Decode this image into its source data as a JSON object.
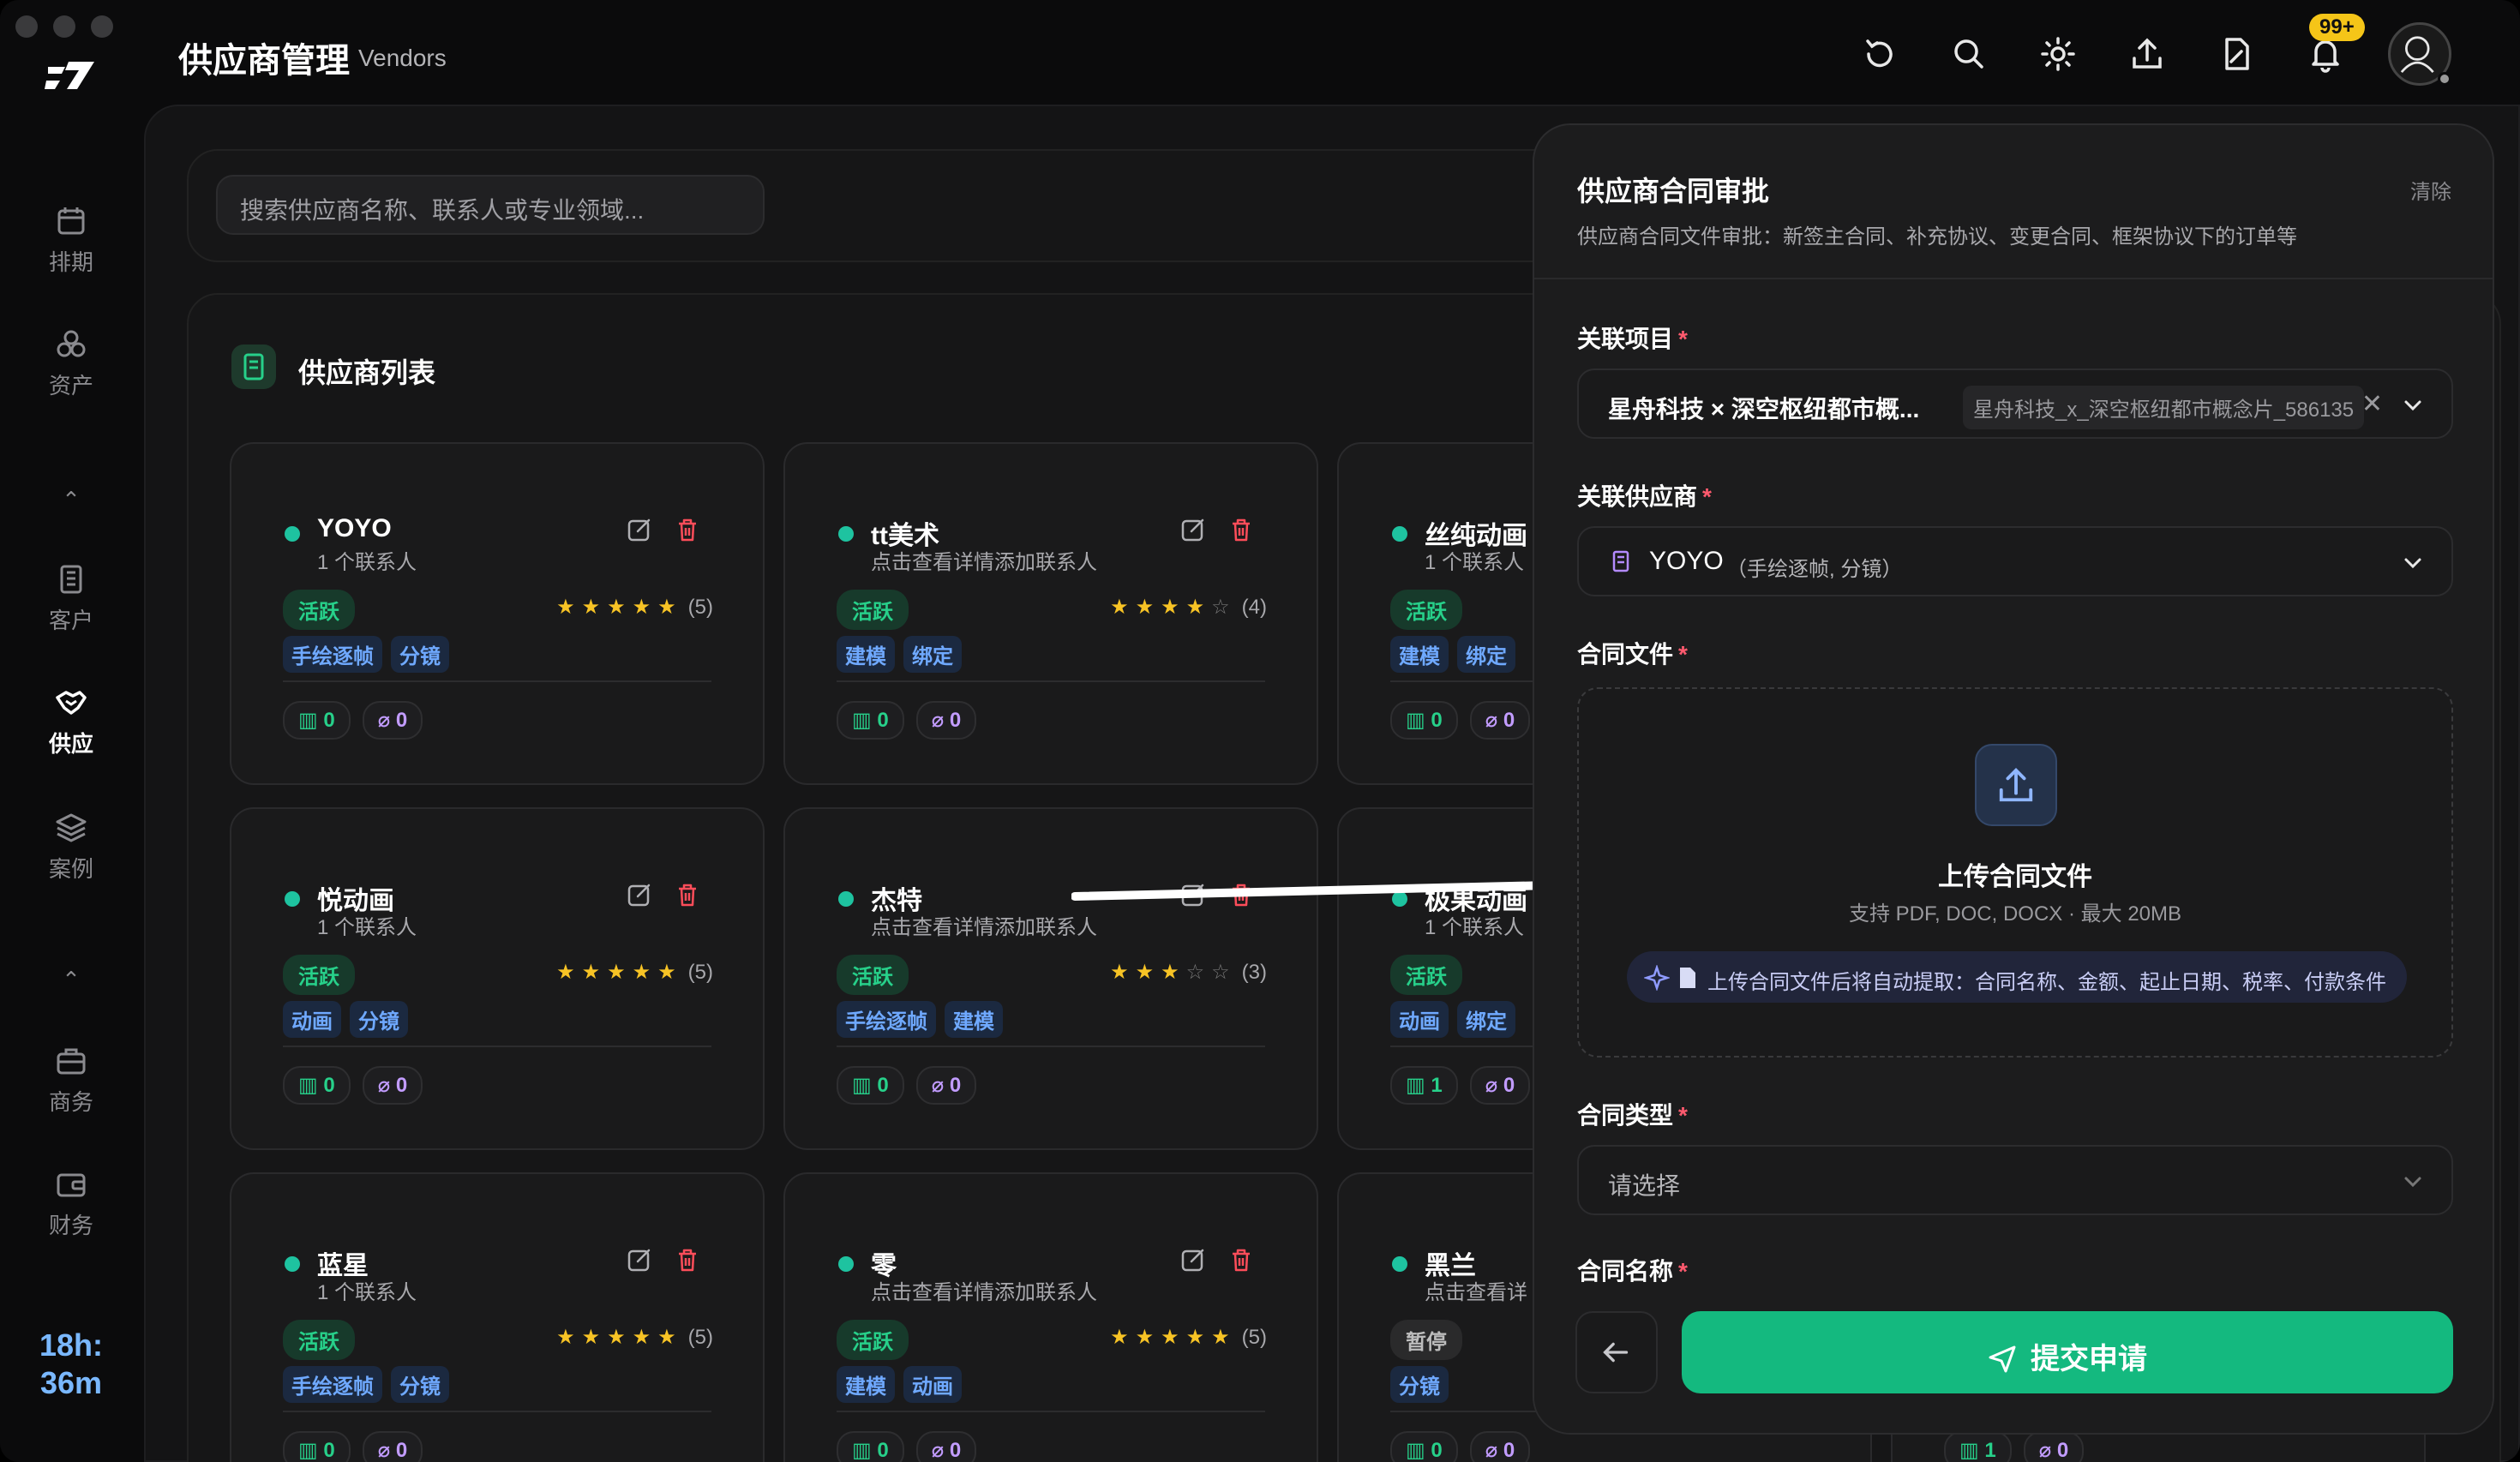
{
  "header": {
    "title": "供应商管理",
    "subtitle": "Vendors",
    "badge": "99+"
  },
  "sidebar": {
    "items": [
      {
        "key": "schedule",
        "label": "排期",
        "icon": "calendar-icon"
      },
      {
        "key": "assets",
        "label": "资产",
        "icon": "assets-icon"
      },
      {
        "key": "clients",
        "label": "客户",
        "icon": "building-icon"
      },
      {
        "key": "vendors",
        "label": "供应",
        "icon": "handshake-icon",
        "active": true
      },
      {
        "key": "cases",
        "label": "案例",
        "icon": "layers-icon"
      },
      {
        "key": "business",
        "label": "商务",
        "icon": "briefcase-icon"
      },
      {
        "key": "finance",
        "label": "财务",
        "icon": "wallet-icon"
      }
    ],
    "timer": [
      "18h:",
      "36m"
    ]
  },
  "search": {
    "placeholder": "搜索供应商名称、联系人或专业领域..."
  },
  "list": {
    "title": "供应商列表",
    "cards": [
      {
        "name": "YOYO",
        "contact": "1 个联系人",
        "status": "活跃",
        "rating": 5,
        "count": "(5)",
        "tags": [
          "手绘逐帧",
          "分镜"
        ],
        "projects": "0",
        "files": "0"
      },
      {
        "name": "tt美术",
        "contact": "点击查看详情添加联系人",
        "status": "活跃",
        "rating": 4,
        "count": "(4)",
        "tags": [
          "建模",
          "绑定"
        ],
        "projects": "0",
        "files": "0"
      },
      {
        "name": "丝纯动画",
        "contact": "1 个联系人",
        "status": "活跃",
        "rating": 0,
        "count": "",
        "tags": [
          "建模",
          "绑定"
        ],
        "projects": "0",
        "files": "0"
      },
      {
        "name": "悦动画",
        "contact": "1 个联系人",
        "status": "活跃",
        "rating": 5,
        "count": "(5)",
        "tags": [
          "动画",
          "分镜"
        ],
        "projects": "0",
        "files": "0"
      },
      {
        "name": "杰特",
        "contact": "点击查看详情添加联系人",
        "status": "活跃",
        "rating": 3,
        "count": "(3)",
        "tags": [
          "手绘逐帧",
          "建模"
        ],
        "projects": "0",
        "files": "0"
      },
      {
        "name": "极果动画",
        "contact": "1 个联系人",
        "status": "活跃",
        "rating": 0,
        "count": "",
        "tags": [
          "动画",
          "绑定"
        ],
        "projects": "1",
        "files": "0"
      },
      {
        "name": "蓝星",
        "contact": "1 个联系人",
        "status": "活跃",
        "rating": 5,
        "count": "(5)",
        "tags": [
          "手绘逐帧",
          "分镜"
        ],
        "projects": "0",
        "files": "0"
      },
      {
        "name": "零",
        "contact": "点击查看详情添加联系人",
        "status": "活跃",
        "rating": 5,
        "count": "(5)",
        "tags": [
          "建模",
          "动画"
        ],
        "projects": "0",
        "files": "0"
      },
      {
        "name": "黑兰",
        "contact": "点击查看详",
        "status": "暂停",
        "rating": 0,
        "count": "",
        "tags": [
          "分镜"
        ],
        "projects": "0",
        "files": "0"
      }
    ],
    "extra_chips": [
      "1",
      "0"
    ]
  },
  "panel": {
    "title": "供应商合同审批",
    "clear": "清除",
    "description": "供应商合同文件审批：新签主合同、补充协议、变更合同、框架协议下的订单等",
    "project_label": "关联项目",
    "project_value": "星舟科技 × 深空枢纽都市概...",
    "project_pill": "星舟科技_x_深空枢纽都市概念片_586135",
    "vendor_label": "关联供应商",
    "vendor_name": "YOYO",
    "vendor_meta": "（手绘逐帧, 分镜）",
    "file_label": "合同文件",
    "upload_title": "上传合同文件",
    "upload_formats": "支持 PDF, DOC, DOCX · 最大 20MB",
    "upload_hint": "上传合同文件后将自动提取：合同名称、金额、起止日期、税率、付款条件",
    "type_label": "合同类型",
    "type_placeholder": "请选择",
    "name_label": "合同名称",
    "required_mark": "*",
    "submit": "提交申请"
  },
  "colors": {
    "accent": "#14b97f",
    "active_dot": "#1ec3a0",
    "star": "#f7c325",
    "tag": "#6fa9ff"
  }
}
